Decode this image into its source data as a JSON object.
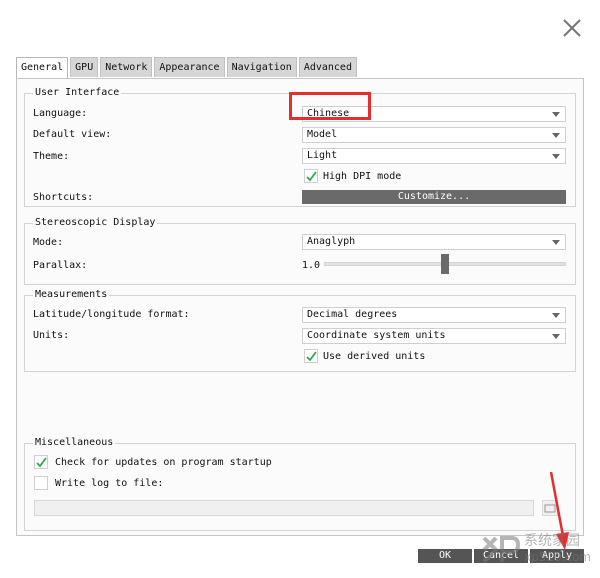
{
  "tabs": [
    {
      "label": "General"
    },
    {
      "label": "GPU"
    },
    {
      "label": "Network"
    },
    {
      "label": "Appearance"
    },
    {
      "label": "Navigation"
    },
    {
      "label": "Advanced"
    }
  ],
  "ui": {
    "title": "User Interface",
    "language_label": "Language:",
    "language_value": "Chinese",
    "default_view_label": "Default view:",
    "default_view_value": "Model",
    "theme_label": "Theme:",
    "theme_value": "Light",
    "high_dpi_label": "High DPI mode",
    "high_dpi_checked": true,
    "shortcuts_label": "Shortcuts:",
    "customize_label": "Customize..."
  },
  "stereo": {
    "title": "Stereoscopic Display",
    "mode_label": "Mode:",
    "mode_value": "Anaglyph",
    "parallax_label": "Parallax:",
    "parallax_value": "1.0",
    "parallax_fraction": 0.5
  },
  "measurements": {
    "title": "Measurements",
    "latlon_label": "Latitude/longitude format:",
    "latlon_value": "Decimal degrees",
    "units_label": "Units:",
    "units_value": "Coordinate system units",
    "derived_label": "Use derived units",
    "derived_checked": true
  },
  "misc": {
    "title": "Miscellaneous",
    "check_updates_label": "Check for updates on program startup",
    "check_updates_checked": true,
    "write_log_label": "Write log to file:",
    "write_log_checked": false,
    "log_path": ""
  },
  "footer": {
    "ok": "OK",
    "cancel": "Cancel",
    "apply": "Apply"
  },
  "watermark": {
    "line1": "系统家园",
    "line2": "xp510.com"
  },
  "colors": {
    "highlight": "#e52f2f",
    "check": "#2fa84f",
    "button": "#6a6a6a"
  }
}
